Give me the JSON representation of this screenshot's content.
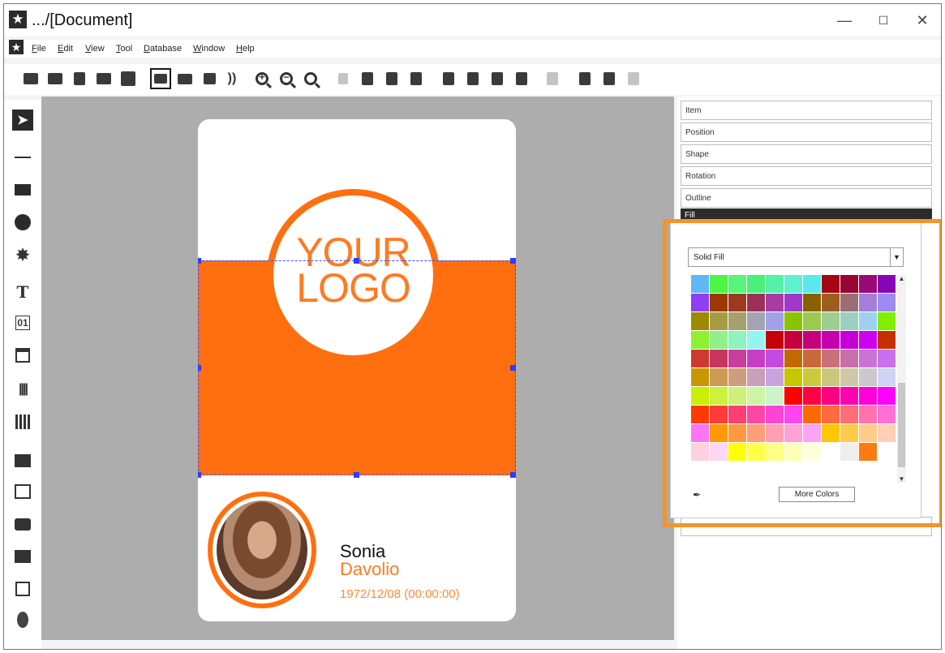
{
  "window": {
    "title": ".../[Document]",
    "minimize": "—",
    "maximize": "☐",
    "close": "✕"
  },
  "menu": [
    "File",
    "Edit",
    "View",
    "Tool",
    "Database",
    "Window",
    "Help"
  ],
  "toolbar": {
    "icons": [
      "new-document-icon",
      "open-icon",
      "save-icon",
      "print-setup-icon",
      "print-icon",
      "card-front-icon",
      "card-back-icon",
      "list-icon",
      "encode-icon",
      "zoom-in-icon",
      "zoom-out-icon",
      "zoom-fit-icon",
      "align-disabled-icon",
      "layer-icon",
      "layer-icon",
      "layer-icon",
      "bring-front-icon",
      "send-back-icon",
      "forward-icon",
      "backward-icon",
      "group-disabled-icon",
      "add-field-icon",
      "remove-field-icon",
      "check-disabled-icon"
    ]
  },
  "left_tools": [
    "pointer-icon",
    "line-icon",
    "rectangle-icon",
    "ellipse-icon",
    "star-shape-icon",
    "text-icon",
    "counter-icon",
    "date-icon",
    "barcode-icon",
    "qrcode-icon",
    "image-field-icon",
    "picture-icon",
    "camera-icon",
    "signature-icon",
    "pen-icon",
    "fingerprint-icon"
  ],
  "card": {
    "logo_line1": "YOUR",
    "logo_line2": "LOGO",
    "first_name": "Sonia",
    "last_name": "Davolio",
    "birthdate": "1972/12/08 (00:00:00)",
    "accent": "#ff6f0f"
  },
  "properties": {
    "sections": [
      "Item",
      "Position",
      "Shape",
      "Rotation",
      "Outline"
    ],
    "fill_header": "Fill",
    "fill_type": "Solid Fill",
    "more_colors": "More Colors",
    "highlight_color": "#f2952a",
    "palette": [
      "#5fb7f5",
      "#4cf542",
      "#57f57a",
      "#4bef79",
      "#56f0a9",
      "#5ef0cf",
      "#58e8ee",
      "#a60610",
      "#9a0434",
      "#9a0a77",
      "#8906b6",
      "#8f3ef0",
      "#9a3a00",
      "#9c3a1d",
      "#9c2f58",
      "#a73ca5",
      "#a038c8",
      "#8a6000",
      "#9e5d1f",
      "#9a6e77",
      "#a37fd8",
      "#9c8cf0",
      "#9c8a00",
      "#a79b41",
      "#a6a06e",
      "#a3a3b4",
      "#a3a0e8",
      "#8ac300",
      "#9bca53",
      "#9fcf90",
      "#9ccfc2",
      "#9fd0f0",
      "#80f000",
      "#8ef030",
      "#92f08a",
      "#90f2bd",
      "#96f4f0",
      "#c5000a",
      "#c5003a",
      "#c5007a",
      "#c600ab",
      "#c400d6",
      "#ce00f0",
      "#c63000",
      "#cd3a32",
      "#c93560",
      "#c93d9d",
      "#c83dc6",
      "#c44be0",
      "#c26a00",
      "#c9683b",
      "#c9707a",
      "#c76fa6",
      "#ca73d6",
      "#c96ff0",
      "#c79700",
      "#cc9a50",
      "#cc9d7e",
      "#c9a0b8",
      "#caa3de",
      "#c8c600",
      "#ccc93d",
      "#cbc77a",
      "#cec8a6",
      "#cac7cf",
      "#d0d3f5",
      "#c9f000",
      "#cdf23d",
      "#cff07a",
      "#cef4a6",
      "#cdf3cb",
      "#ff0000",
      "#ff0044",
      "#ff0080",
      "#ff00b0",
      "#ff00d8",
      "#ff00ff",
      "#ff3a00",
      "#ff3a3a",
      "#ff3e74",
      "#ff44a7",
      "#ff44d4",
      "#ff44f0",
      "#ff6a00",
      "#ff6a3e",
      "#ff6e78",
      "#ff72ae",
      "#ff70d6",
      "#ff74f4",
      "#ff9900",
      "#ff9a40",
      "#ff9e7a",
      "#ffa0b0",
      "#ffa2d8",
      "#ffa2f5",
      "#ffc700",
      "#ffc94a",
      "#ffcc8a",
      "#ffcfb6",
      "#ffd0de",
      "#ffd6f6",
      "#ffff00",
      "#ffff4a",
      "#ffff88",
      "#ffffb5",
      "#ffffdd",
      "#ffffff",
      "#eeeeee",
      "#ff7a10"
    ]
  }
}
